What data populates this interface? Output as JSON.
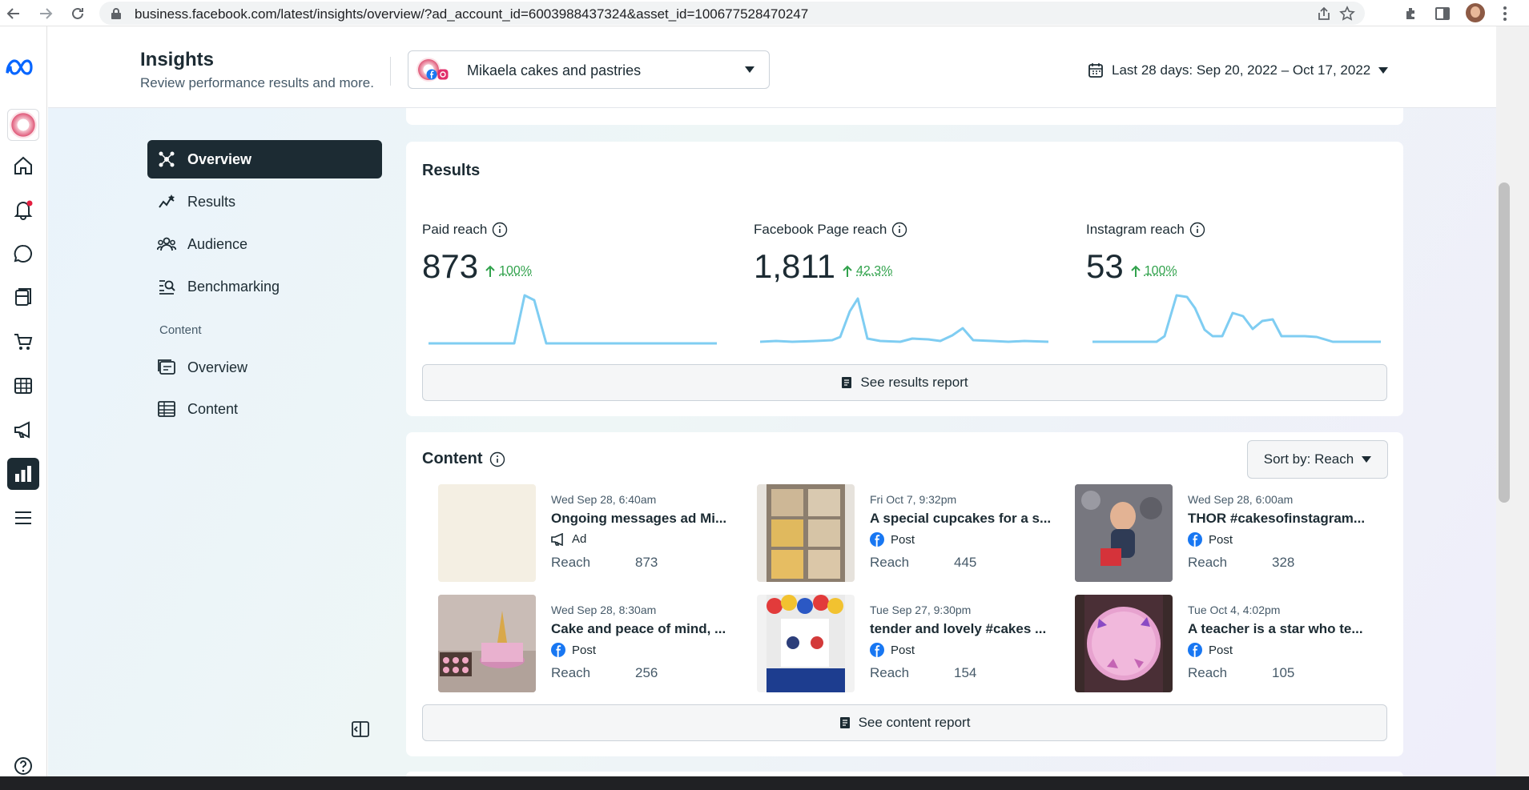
{
  "browser": {
    "url": "business.facebook.com/latest/insights/overview/?ad_account_id=6003988437324&asset_id=100677528470247"
  },
  "header": {
    "title": "Insights",
    "subtitle": "Review performance results and more.",
    "account_name": "Mikaela cakes and pastries",
    "date_range": "Last 28 days: Sep 20, 2022 – Oct 17, 2022"
  },
  "sidebar": {
    "items": [
      {
        "label": "Overview",
        "icon": "overview-icon"
      },
      {
        "label": "Results",
        "icon": "results-icon"
      },
      {
        "label": "Audience",
        "icon": "audience-icon"
      },
      {
        "label": "Benchmarking",
        "icon": "benchmarking-icon"
      }
    ],
    "section_label": "Content",
    "content_items": [
      {
        "label": "Overview",
        "icon": "content-overview-icon"
      },
      {
        "label": "Content",
        "icon": "content-table-icon"
      }
    ]
  },
  "results": {
    "title": "Results",
    "metrics": [
      {
        "label": "Paid reach",
        "value": "873",
        "change": "100%"
      },
      {
        "label": "Facebook Page reach",
        "value": "1,811",
        "change": "42.3%"
      },
      {
        "label": "Instagram reach",
        "value": "53",
        "change": "100%"
      }
    ],
    "report_button": "See results report"
  },
  "content": {
    "title": "Content",
    "sort_label": "Sort by: Reach",
    "posts": [
      {
        "date": "Wed Sep 28, 6:40am",
        "title": "Ongoing messages ad Mi...",
        "type": "Ad",
        "reach_label": "Reach",
        "reach": "873"
      },
      {
        "date": "Fri Oct 7, 9:32pm",
        "title": "A special cupcakes for a s...",
        "type": "Post",
        "reach_label": "Reach",
        "reach": "445"
      },
      {
        "date": "Wed Sep 28, 6:00am",
        "title": "THOR #cakesofinstagram...",
        "type": "Post",
        "reach_label": "Reach",
        "reach": "328"
      },
      {
        "date": "Wed Sep 28, 8:30am",
        "title": "Cake and peace of mind, ...",
        "type": "Post",
        "reach_label": "Reach",
        "reach": "256"
      },
      {
        "date": "Tue Sep 27, 9:30pm",
        "title": "tender and lovely #cakes ...",
        "type": "Post",
        "reach_label": "Reach",
        "reach": "154"
      },
      {
        "date": "Tue Oct 4, 4:02pm",
        "title": "A teacher is a star who te...",
        "type": "Post",
        "reach_label": "Reach",
        "reach": "105"
      }
    ],
    "report_button": "See content report"
  },
  "colors": {
    "accent_dark": "#1c2b33",
    "positive": "#31a24c",
    "sparkline": "#7fcdf2",
    "facebook_blue": "#1877f2"
  }
}
